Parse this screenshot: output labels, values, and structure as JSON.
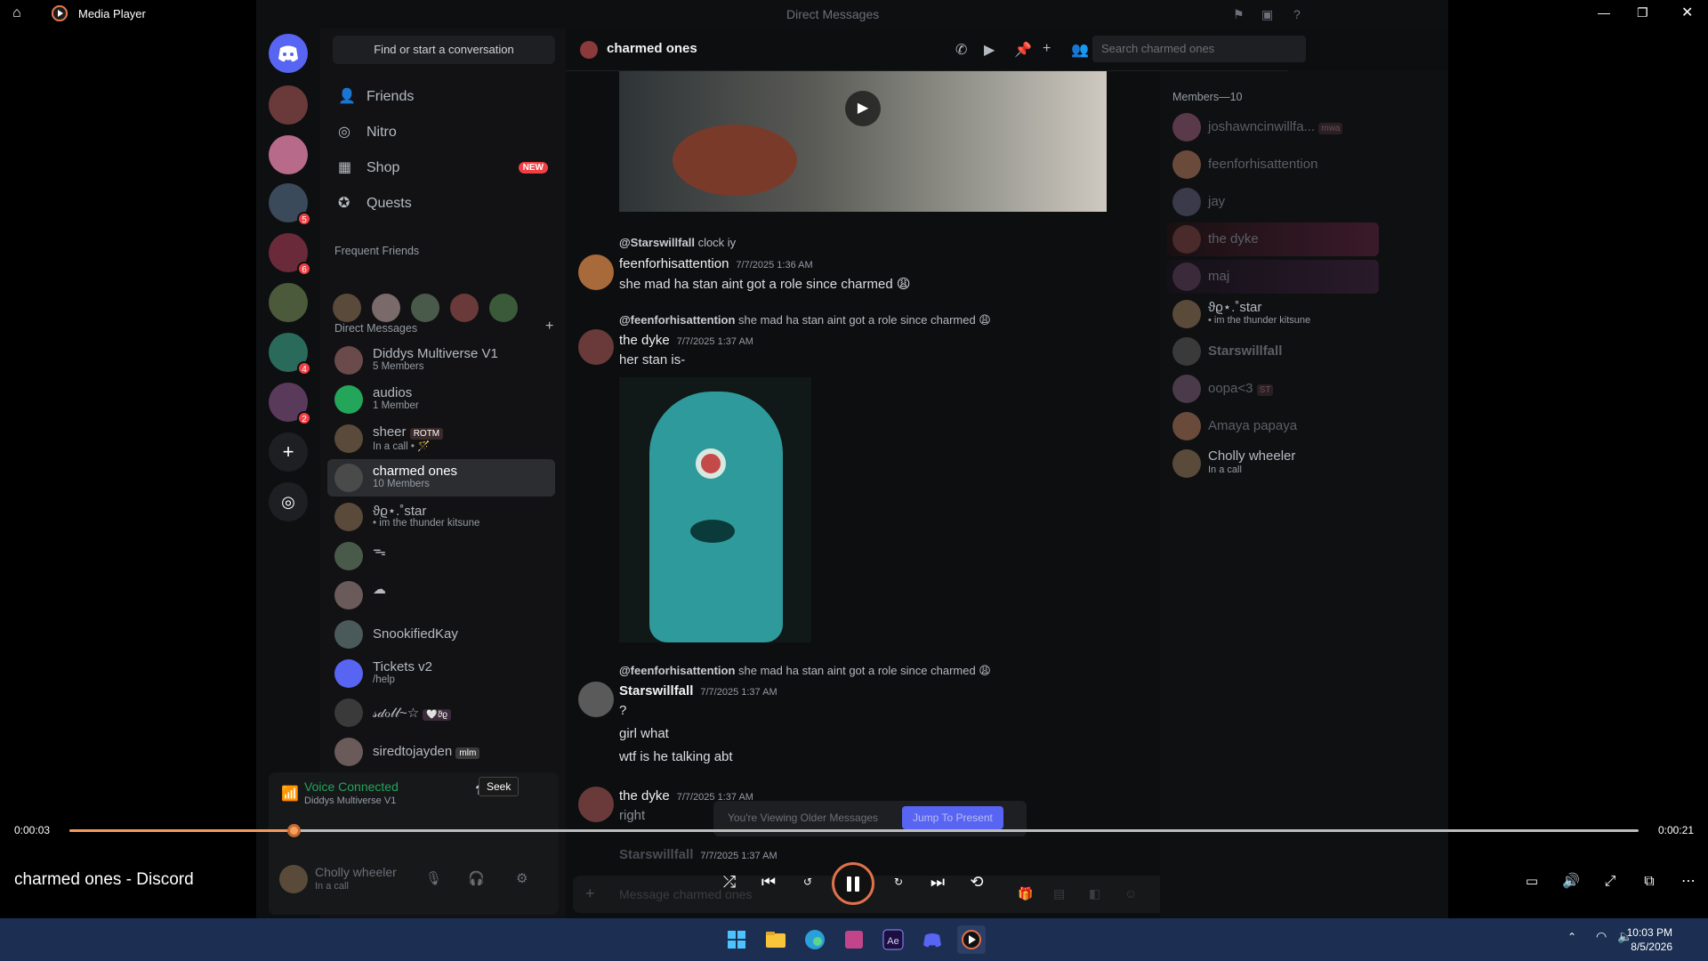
{
  "media_player": {
    "window_title": "Media Player",
    "now_playing": "charmed ones - Discord",
    "time_current": "0:00:03",
    "time_total": "0:00:21",
    "progress_fraction": 0.143,
    "seek_tooltip": "Seek"
  },
  "discord": {
    "window_title": "Direct Messages",
    "find_conversation": "Find or start a conversation",
    "nav": [
      {
        "label": "Friends"
      },
      {
        "label": "Nitro"
      },
      {
        "label": "Shop",
        "badge": "NEW"
      },
      {
        "label": "Quests"
      }
    ],
    "frequent_friends_header": "Frequent Friends",
    "direct_messages_header": "Direct Messages",
    "guild_badges": [
      "5",
      "6",
      "4",
      "2"
    ],
    "dms": [
      {
        "name": "Diddys Multiverse V1",
        "sub": "5 Members"
      },
      {
        "name": "audios",
        "sub": "1 Member"
      },
      {
        "name": "sheer",
        "tag": "ROTM",
        "sub": "In a call • 🪄"
      },
      {
        "name": "charmed ones",
        "sub": "10 Members"
      },
      {
        "name": "ϑϱ⋆.˚star",
        "sub": "• im the thunder kitsune"
      },
      {
        "name": "ᯓ",
        "sub": ""
      },
      {
        "name": "☁",
        "sub": ""
      },
      {
        "name": "SnookifiedKay",
        "sub": ""
      },
      {
        "name": "Tickets v2",
        "sub": "/help"
      },
      {
        "name": "𝓈𝒹ℴ𝓁𝓁~☆",
        "tag": "🤍ϑϱ",
        "sub": ""
      },
      {
        "name": "siredtojayden",
        "tag": "mlm",
        "sub": ""
      }
    ],
    "voice": {
      "status": "Voice Connected",
      "channel": "Diddys Multiverse V1"
    },
    "user": {
      "name": "Cholly wheeler",
      "status": "In a call"
    },
    "channel": {
      "name": "charmed ones",
      "search_placeholder": "Search charmed ones"
    },
    "messages": [
      {
        "reply_author": "@Starswillfall",
        "reply_text": "clock iy",
        "author": "feenforhisattention",
        "time": "7/7/2025 1:36 AM",
        "lines": [
          "she mad ha stan aint got a role since charmed 😩"
        ]
      },
      {
        "reply_author": "@feenforhisattention",
        "reply_text": "she mad ha stan aint got a role since charmed 😩",
        "author": "the dyke",
        "time": "7/7/2025 1:37 AM",
        "lines": [
          "her stan is-"
        ]
      },
      {
        "reply_author": "@feenforhisattention",
        "reply_text": "she mad ha stan aint got a role since charmed 😩",
        "author": "Starswillfall",
        "time": "7/7/2025 1:37 AM",
        "lines": [
          "?",
          "girl what",
          "wtf is he talking abt"
        ]
      },
      {
        "author": "the dyke",
        "time": "7/7/2025 1:37 AM",
        "lines": [
          "right"
        ]
      },
      {
        "author": "Starswillfall",
        "time": "7/7/2025 1:37 AM",
        "lines": []
      }
    ],
    "older_banner": "You're Viewing Older Messages",
    "jump_button": "Jump To Present",
    "composer_placeholder": "Message charmed ones",
    "members_header": "Members—10",
    "members": [
      {
        "name": "joshawncinwillfa...",
        "tag": "mwa",
        "sub": ""
      },
      {
        "name": "feenforhisattention",
        "sub": ""
      },
      {
        "name": "jay",
        "sub": ""
      },
      {
        "name": "the dyke",
        "sub": ""
      },
      {
        "name": "maj",
        "sub": ""
      },
      {
        "name": "ϑϱ⋆.˚star",
        "sub": "• im the thunder kitsune"
      },
      {
        "name": "Starswillfall",
        "sub": ""
      },
      {
        "name": "oopa<3",
        "tag": "ST",
        "sub": ""
      },
      {
        "name": "Amaya papaya",
        "sub": ""
      },
      {
        "name": "Cholly wheeler",
        "sub": "In a call"
      }
    ]
  },
  "taskbar": {
    "time": "10:03 PM",
    "date": "8/5/2026"
  },
  "colors": {
    "accent_orange": "#f59a5b",
    "discord_blurple": "#5865f2",
    "taskbar": "#1c2f52"
  }
}
